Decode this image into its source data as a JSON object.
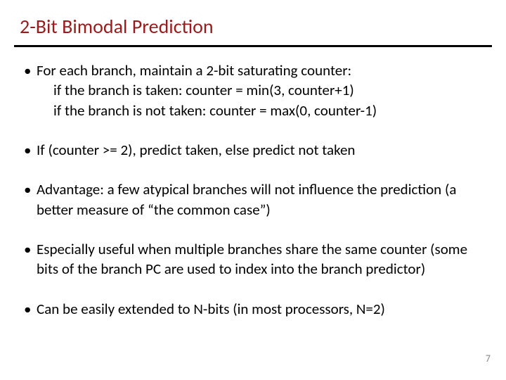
{
  "title": "2-Bit Bimodal Prediction",
  "bullets": [
    {
      "lead": "For each branch, maintain a 2-bit saturating counter:",
      "lines": [
        "if the branch is taken: counter = min(3, counter+1)",
        "if the branch is not taken: counter = max(0, counter-1)"
      ]
    },
    {
      "lead": "If (counter >= 2), predict taken, else predict not taken",
      "lines": []
    },
    {
      "lead": "Advantage: a few atypical branches will not influence the prediction (a better measure of “the common case”)",
      "lines": []
    },
    {
      "lead": "Especially useful when multiple branches share the same counter (some bits of the branch PC are used to index into the branch predictor)",
      "lines": []
    },
    {
      "lead": "Can be easily extended to N-bits (in most processors, N=2)",
      "lines": []
    }
  ],
  "page_number": "7"
}
